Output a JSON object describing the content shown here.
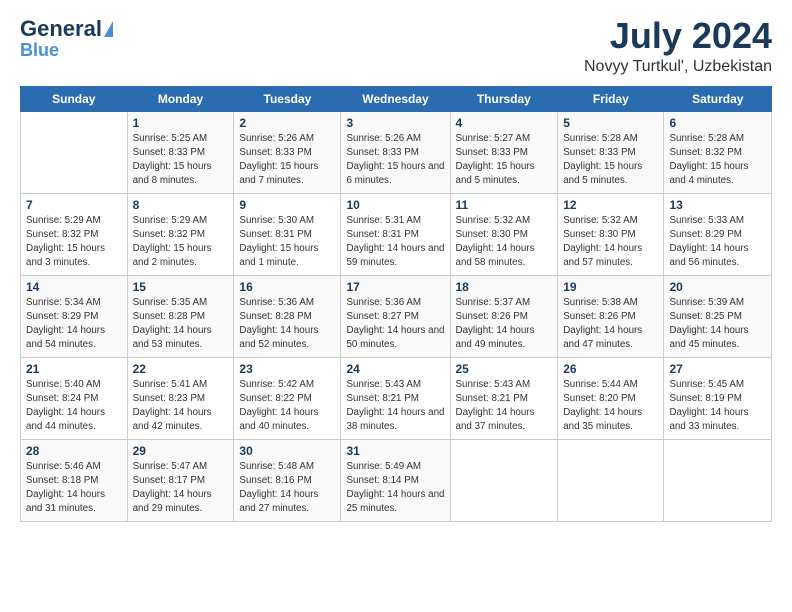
{
  "header": {
    "logo_general": "General",
    "logo_blue": "Blue",
    "month": "July 2024",
    "location": "Novyy Turtkul', Uzbekistan"
  },
  "weekdays": [
    "Sunday",
    "Monday",
    "Tuesday",
    "Wednesday",
    "Thursday",
    "Friday",
    "Saturday"
  ],
  "weeks": [
    [
      {
        "day": "",
        "sunrise": "",
        "sunset": "",
        "daylight": ""
      },
      {
        "day": "1",
        "sunrise": "Sunrise: 5:25 AM",
        "sunset": "Sunset: 8:33 PM",
        "daylight": "Daylight: 15 hours and 8 minutes."
      },
      {
        "day": "2",
        "sunrise": "Sunrise: 5:26 AM",
        "sunset": "Sunset: 8:33 PM",
        "daylight": "Daylight: 15 hours and 7 minutes."
      },
      {
        "day": "3",
        "sunrise": "Sunrise: 5:26 AM",
        "sunset": "Sunset: 8:33 PM",
        "daylight": "Daylight: 15 hours and 6 minutes."
      },
      {
        "day": "4",
        "sunrise": "Sunrise: 5:27 AM",
        "sunset": "Sunset: 8:33 PM",
        "daylight": "Daylight: 15 hours and 5 minutes."
      },
      {
        "day": "5",
        "sunrise": "Sunrise: 5:28 AM",
        "sunset": "Sunset: 8:33 PM",
        "daylight": "Daylight: 15 hours and 5 minutes."
      },
      {
        "day": "6",
        "sunrise": "Sunrise: 5:28 AM",
        "sunset": "Sunset: 8:32 PM",
        "daylight": "Daylight: 15 hours and 4 minutes."
      }
    ],
    [
      {
        "day": "7",
        "sunrise": "Sunrise: 5:29 AM",
        "sunset": "Sunset: 8:32 PM",
        "daylight": "Daylight: 15 hours and 3 minutes."
      },
      {
        "day": "8",
        "sunrise": "Sunrise: 5:29 AM",
        "sunset": "Sunset: 8:32 PM",
        "daylight": "Daylight: 15 hours and 2 minutes."
      },
      {
        "day": "9",
        "sunrise": "Sunrise: 5:30 AM",
        "sunset": "Sunset: 8:31 PM",
        "daylight": "Daylight: 15 hours and 1 minute."
      },
      {
        "day": "10",
        "sunrise": "Sunrise: 5:31 AM",
        "sunset": "Sunset: 8:31 PM",
        "daylight": "Daylight: 14 hours and 59 minutes."
      },
      {
        "day": "11",
        "sunrise": "Sunrise: 5:32 AM",
        "sunset": "Sunset: 8:30 PM",
        "daylight": "Daylight: 14 hours and 58 minutes."
      },
      {
        "day": "12",
        "sunrise": "Sunrise: 5:32 AM",
        "sunset": "Sunset: 8:30 PM",
        "daylight": "Daylight: 14 hours and 57 minutes."
      },
      {
        "day": "13",
        "sunrise": "Sunrise: 5:33 AM",
        "sunset": "Sunset: 8:29 PM",
        "daylight": "Daylight: 14 hours and 56 minutes."
      }
    ],
    [
      {
        "day": "14",
        "sunrise": "Sunrise: 5:34 AM",
        "sunset": "Sunset: 8:29 PM",
        "daylight": "Daylight: 14 hours and 54 minutes."
      },
      {
        "day": "15",
        "sunrise": "Sunrise: 5:35 AM",
        "sunset": "Sunset: 8:28 PM",
        "daylight": "Daylight: 14 hours and 53 minutes."
      },
      {
        "day": "16",
        "sunrise": "Sunrise: 5:36 AM",
        "sunset": "Sunset: 8:28 PM",
        "daylight": "Daylight: 14 hours and 52 minutes."
      },
      {
        "day": "17",
        "sunrise": "Sunrise: 5:36 AM",
        "sunset": "Sunset: 8:27 PM",
        "daylight": "Daylight: 14 hours and 50 minutes."
      },
      {
        "day": "18",
        "sunrise": "Sunrise: 5:37 AM",
        "sunset": "Sunset: 8:26 PM",
        "daylight": "Daylight: 14 hours and 49 minutes."
      },
      {
        "day": "19",
        "sunrise": "Sunrise: 5:38 AM",
        "sunset": "Sunset: 8:26 PM",
        "daylight": "Daylight: 14 hours and 47 minutes."
      },
      {
        "day": "20",
        "sunrise": "Sunrise: 5:39 AM",
        "sunset": "Sunset: 8:25 PM",
        "daylight": "Daylight: 14 hours and 45 minutes."
      }
    ],
    [
      {
        "day": "21",
        "sunrise": "Sunrise: 5:40 AM",
        "sunset": "Sunset: 8:24 PM",
        "daylight": "Daylight: 14 hours and 44 minutes."
      },
      {
        "day": "22",
        "sunrise": "Sunrise: 5:41 AM",
        "sunset": "Sunset: 8:23 PM",
        "daylight": "Daylight: 14 hours and 42 minutes."
      },
      {
        "day": "23",
        "sunrise": "Sunrise: 5:42 AM",
        "sunset": "Sunset: 8:22 PM",
        "daylight": "Daylight: 14 hours and 40 minutes."
      },
      {
        "day": "24",
        "sunrise": "Sunrise: 5:43 AM",
        "sunset": "Sunset: 8:21 PM",
        "daylight": "Daylight: 14 hours and 38 minutes."
      },
      {
        "day": "25",
        "sunrise": "Sunrise: 5:43 AM",
        "sunset": "Sunset: 8:21 PM",
        "daylight": "Daylight: 14 hours and 37 minutes."
      },
      {
        "day": "26",
        "sunrise": "Sunrise: 5:44 AM",
        "sunset": "Sunset: 8:20 PM",
        "daylight": "Daylight: 14 hours and 35 minutes."
      },
      {
        "day": "27",
        "sunrise": "Sunrise: 5:45 AM",
        "sunset": "Sunset: 8:19 PM",
        "daylight": "Daylight: 14 hours and 33 minutes."
      }
    ],
    [
      {
        "day": "28",
        "sunrise": "Sunrise: 5:46 AM",
        "sunset": "Sunset: 8:18 PM",
        "daylight": "Daylight: 14 hours and 31 minutes."
      },
      {
        "day": "29",
        "sunrise": "Sunrise: 5:47 AM",
        "sunset": "Sunset: 8:17 PM",
        "daylight": "Daylight: 14 hours and 29 minutes."
      },
      {
        "day": "30",
        "sunrise": "Sunrise: 5:48 AM",
        "sunset": "Sunset: 8:16 PM",
        "daylight": "Daylight: 14 hours and 27 minutes."
      },
      {
        "day": "31",
        "sunrise": "Sunrise: 5:49 AM",
        "sunset": "Sunset: 8:14 PM",
        "daylight": "Daylight: 14 hours and 25 minutes."
      },
      {
        "day": "",
        "sunrise": "",
        "sunset": "",
        "daylight": ""
      },
      {
        "day": "",
        "sunrise": "",
        "sunset": "",
        "daylight": ""
      },
      {
        "day": "",
        "sunrise": "",
        "sunset": "",
        "daylight": ""
      }
    ]
  ]
}
